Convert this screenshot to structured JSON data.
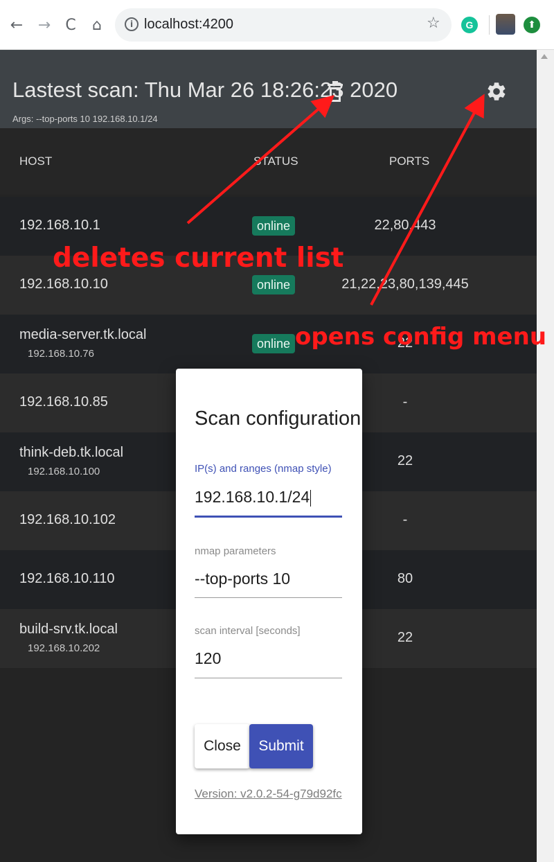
{
  "browser": {
    "url": "localhost:4200",
    "info_glyph": "i",
    "back_glyph": "←",
    "forward_glyph": "→",
    "reload_glyph": "C",
    "home_glyph": "⌂",
    "star_glyph": "☆",
    "grammarly_letter": "G",
    "update_glyph": "⬆"
  },
  "header": {
    "title": "Lastest scan: Thu Mar 26 18:26:23 2020",
    "args": "Args: --top-ports 10 192.168.10.1/24"
  },
  "table": {
    "columns": [
      "HOST",
      "STATUS",
      "PORTS"
    ],
    "rows": [
      {
        "host": "192.168.10.1",
        "ip": "",
        "status": "online",
        "ports": "22,80,443"
      },
      {
        "host": "192.168.10.10",
        "ip": "",
        "status": "online",
        "ports": "21,22,23,80,139,445"
      },
      {
        "host": "media-server.tk.local",
        "ip": "192.168.10.76",
        "status": "online",
        "ports": "22"
      },
      {
        "host": "192.168.10.85",
        "ip": "",
        "status": "",
        "ports": "-"
      },
      {
        "host": "think-deb.tk.local",
        "ip": "192.168.10.100",
        "status": "",
        "ports": "22"
      },
      {
        "host": "192.168.10.102",
        "ip": "",
        "status": "",
        "ports": "-"
      },
      {
        "host": "192.168.10.110",
        "ip": "",
        "status": "",
        "ports": "80"
      },
      {
        "host": "build-srv.tk.local",
        "ip": "192.168.10.202",
        "status": "",
        "ports": "22"
      }
    ]
  },
  "modal": {
    "title": "Scan configuration",
    "fields": [
      {
        "label": "IP(s) and ranges (nmap style)",
        "value": "192.168.10.1/24"
      },
      {
        "label": "nmap parameters",
        "value": "--top-ports 10"
      },
      {
        "label": "scan interval [seconds]",
        "value": "120"
      }
    ],
    "close_label": "Close",
    "submit_label": "Submit",
    "version": "Version: v2.0.2-54-g79d92fc"
  },
  "annotations": {
    "delete_note": "deletes current list",
    "config_note": "opens config menu"
  },
  "colors": {
    "header_bg": "#3e4347",
    "row_dark": "#202225",
    "row_light": "#2c2c2c",
    "status_chip": "#167a5c",
    "accent": "#3f51b5",
    "annotation": "#ff1a1a"
  },
  "icons": {
    "delete": "trash-icon",
    "settings": "gear-icon"
  }
}
